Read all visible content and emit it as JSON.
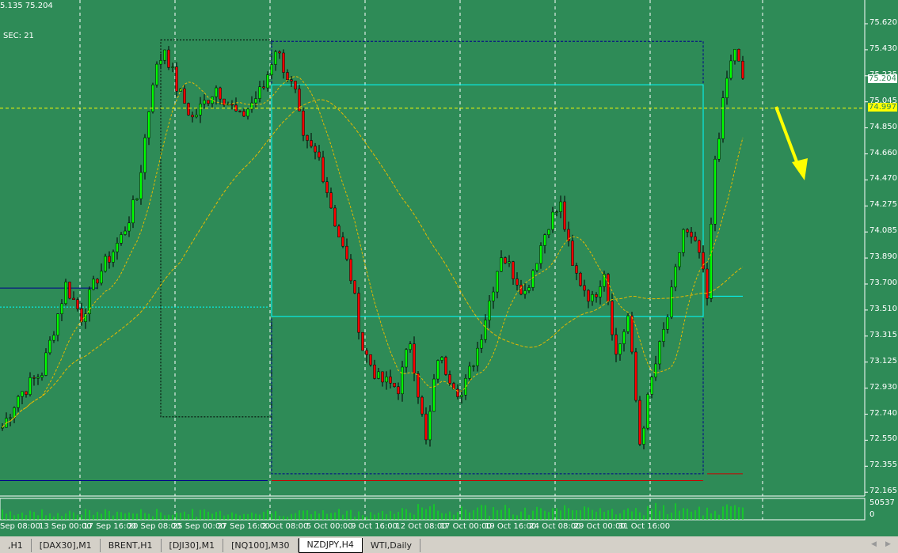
{
  "header": {
    "ohlc_text": "5.135 75.204",
    "sec_label": "SEC: 21"
  },
  "price_axis": {
    "labels": [
      "75.620",
      "75.430",
      "75.235",
      "75.045",
      "74.850",
      "74.660",
      "74.470",
      "74.275",
      "74.085",
      "73.890",
      "73.700",
      "73.510",
      "73.315",
      "73.125",
      "72.930",
      "72.740",
      "72.550",
      "72.355",
      "72.165"
    ],
    "bid_label": "75.204",
    "line_label": "74.997"
  },
  "volume_axis": {
    "max": "50537",
    "min": "0"
  },
  "time_axis": [
    "Sep 08:00",
    "13 Sep 00:00",
    "17 Sep 16:00",
    "20 Sep 08:00",
    "25 Sep 00:00",
    "27 Sep 16:00",
    "2 Oct 08:00",
    "5 Oct 00:00",
    "9 Oct 16:00",
    "12 Oct 08:00",
    "17 Oct 00:00",
    "19 Oct 16:00",
    "24 Oct 08:00",
    "29 Oct 00:00",
    "31 Oct 16:00"
  ],
  "tabs": [
    {
      "label": ",H1"
    },
    {
      "label": "[DAX30],M1"
    },
    {
      "label": "BRENT,H1"
    },
    {
      "label": "[DJI30],M1"
    },
    {
      "label": "[NQ100],M30"
    },
    {
      "label": "NZDJPY,H4",
      "active": true
    },
    {
      "label": "WTI,Daily"
    }
  ],
  "colors": {
    "background": "#2e8b57",
    "bull": "#00ff00",
    "bear": "#ff0000",
    "line": "#ffff00",
    "box": "#00ffff"
  },
  "chart_data": {
    "type": "candlestick",
    "symbol": "NZDJPY",
    "timeframe": "H4",
    "waypoints": [
      [
        0,
        72.644
      ],
      [
        4,
        72.877
      ],
      [
        10,
        73.052
      ],
      [
        16,
        73.694
      ],
      [
        20,
        73.461
      ],
      [
        24,
        73.752
      ],
      [
        30,
        74.044
      ],
      [
        34,
        74.336
      ],
      [
        38,
        75.211
      ],
      [
        41,
        75.445
      ],
      [
        44,
        75.153
      ],
      [
        48,
        74.92
      ],
      [
        54,
        75.153
      ],
      [
        60,
        74.92
      ],
      [
        66,
        75.153
      ],
      [
        69,
        75.445
      ],
      [
        74,
        75.095
      ],
      [
        76,
        74.745
      ],
      [
        80,
        74.628
      ],
      [
        84,
        74.161
      ],
      [
        88,
        73.752
      ],
      [
        91,
        73.227
      ],
      [
        95,
        72.994
      ],
      [
        100,
        72.935
      ],
      [
        103,
        73.286
      ],
      [
        107,
        72.527
      ],
      [
        110,
        73.169
      ],
      [
        116,
        72.877
      ],
      [
        120,
        73.227
      ],
      [
        126,
        73.927
      ],
      [
        132,
        73.636
      ],
      [
        138,
        74.161
      ],
      [
        141,
        74.278
      ],
      [
        144,
        73.81
      ],
      [
        149,
        73.577
      ],
      [
        152,
        73.81
      ],
      [
        155,
        73.169
      ],
      [
        158,
        73.461
      ],
      [
        161,
        72.527
      ],
      [
        164,
        72.994
      ],
      [
        168,
        73.461
      ],
      [
        172,
        74.102
      ],
      [
        176,
        73.927
      ],
      [
        178,
        73.577
      ],
      [
        180,
        74.628
      ],
      [
        183,
        75.211
      ],
      [
        185,
        75.445
      ],
      [
        187,
        75.183
      ]
    ],
    "current_line": 74.997,
    "bid": 75.204,
    "ylim": [
      72.165,
      75.62
    ]
  }
}
